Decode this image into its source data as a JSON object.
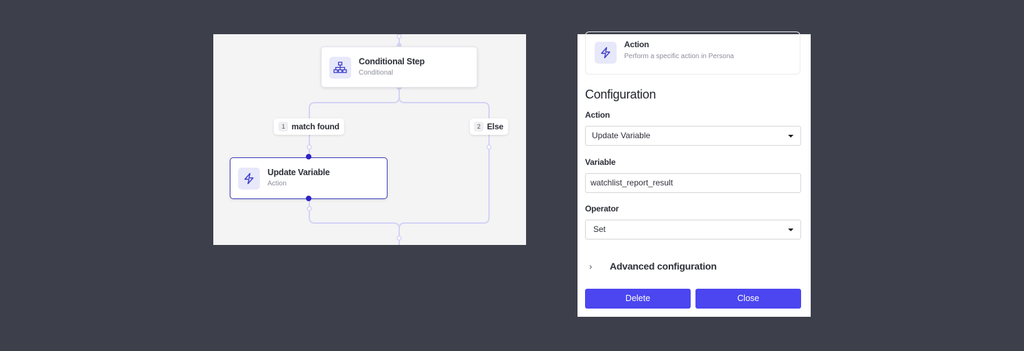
{
  "canvas": {
    "conditional_node": {
      "title": "Conditional Step",
      "subtitle": "Conditional",
      "icon": "sitemap-icon"
    },
    "branch_1": {
      "number": "1",
      "label": "match found"
    },
    "branch_2": {
      "number": "2",
      "label": "Else"
    },
    "action_node": {
      "title": "Update Variable",
      "subtitle": "Action",
      "icon": "lightning-icon",
      "selected": true
    },
    "wire_color": "#d4d3f5",
    "accent": "#2d22c4"
  },
  "panel": {
    "type_card": {
      "title": "Action",
      "description": "Perform a specific action in Persona",
      "icon": "lightning-icon"
    },
    "section_title": "Configuration",
    "action": {
      "label": "Action",
      "value": "Update Variable"
    },
    "variable": {
      "label": "Variable",
      "value": "watchlist_report_result"
    },
    "operator": {
      "label": "Operator",
      "value": "Set"
    },
    "advanced_label": "Advanced configuration",
    "delete_label": "Delete",
    "close_label": "Close",
    "button_color": "#4b46f0"
  }
}
